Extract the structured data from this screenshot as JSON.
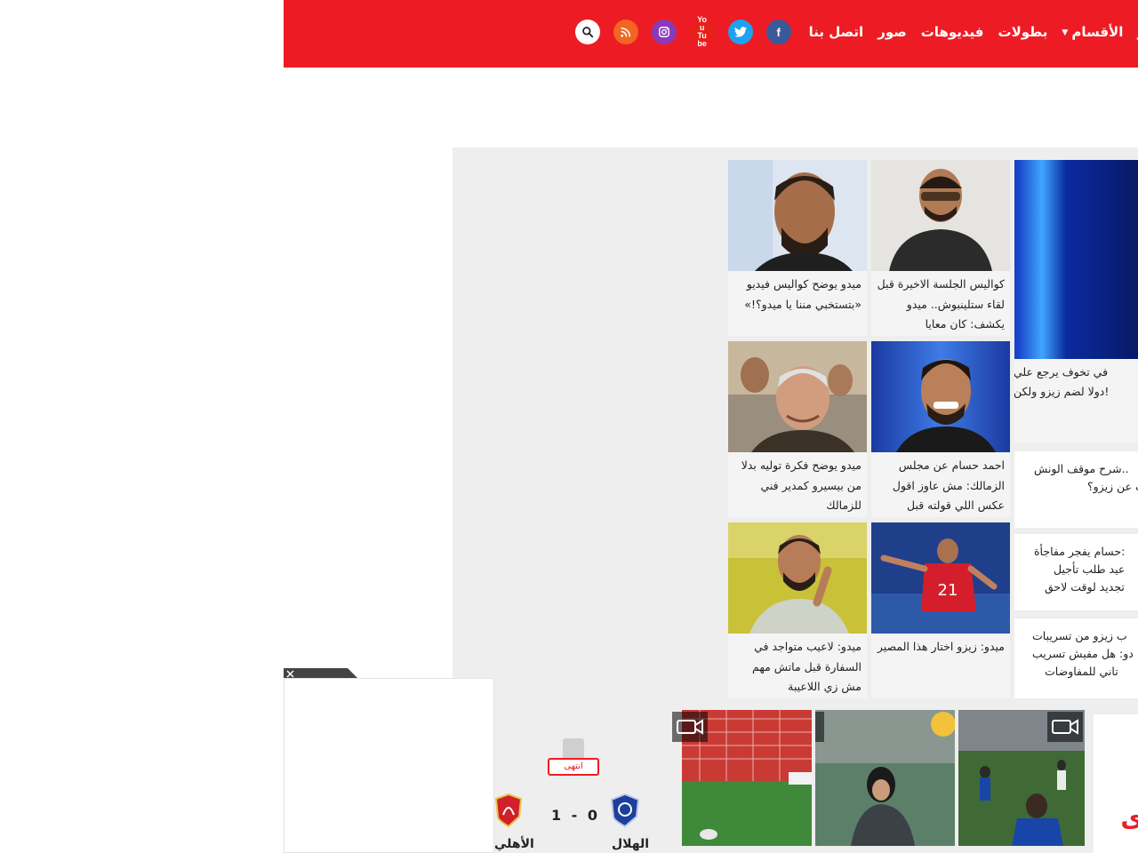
{
  "nav": {
    "items": [
      "الأقسام",
      "بطولات",
      "فيديوهات",
      "صور",
      "اتصل بنا"
    ],
    "truncated_item": "ر"
  },
  "socials": [
    "facebook-icon",
    "twitter-icon",
    "youtube-icon",
    "instagram-icon",
    "rss-icon",
    "search-icon"
  ],
  "youtube_label": "You Tube",
  "featured": {
    "title_line1": "في تخوف يرجع علي",
    "title_line2": "دولا لضم زيزو ولكن!"
  },
  "side_list": [
    {
      "line1": "شرح موقف الونش..",
      "line2": "ب عن زيزو؟",
      "line3": ""
    },
    {
      "line1": "حسام يفجر مفاجأة:",
      "line2": "عيد طلب تأجيل",
      "line3": "تجديد لوقت لاحق"
    },
    {
      "line1": "ب زيزو من تسريبات",
      "line2": "دو: هل مفيش تسريب",
      "line3": "تاني للمفاوضات"
    }
  ],
  "cards": [
    {
      "title": "كواليس الجلسة الاخيرة قبل لقاء ستلينبوش.. ميدو يكشف: كان معايا"
    },
    {
      "title": "ميدو يوضح كواليس فيديو «بتستخبي مننا يا ميدو؟!»"
    },
    {
      "title": "احمد حسام عن مجلس الزمالك: مش عاوز اقول عكس اللي قولته قبل"
    },
    {
      "title": "ميدو يوضح فكرة توليه بدلا من بيسيرو كمدير فني للزمالك"
    },
    {
      "title": "ميدو: زيزو اختار هذا المصير"
    },
    {
      "title": "ميدو: لاعيب متواجد في السفارة قبل ماتش مهم مش زي اللاعيبة"
    }
  ],
  "match": {
    "status": "انتهى",
    "home_team": "الهلال",
    "away_team": "الأهلي",
    "home_score": "0",
    "away_score": "1",
    "separator": "-"
  },
  "colors": {
    "brand_red": "#ed1c24",
    "panel_gray": "#eeeeee",
    "facebook": "#3b5998",
    "twitter": "#1da1f2",
    "youtube": "#e62117",
    "instagram": "#8a3ab9",
    "rss": "#f26522"
  }
}
